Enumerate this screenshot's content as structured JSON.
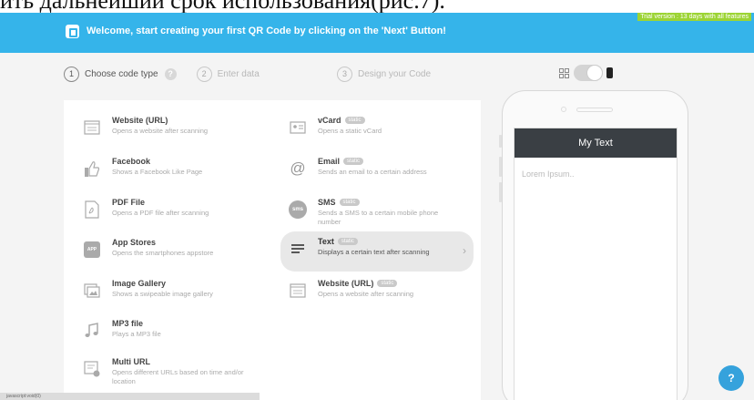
{
  "caption": "ить дальнейший срок использования(рис.7).",
  "trial": "Trial version : 13 days with all features",
  "banner": {
    "welcome": "Welcome, start creating your first QR Code by clicking on the 'Next' Button!"
  },
  "steps": [
    {
      "num": "1",
      "label": "Choose code type"
    },
    {
      "num": "2",
      "label": "Enter data"
    },
    {
      "num": "3",
      "label": "Design your Code"
    }
  ],
  "left_items": [
    {
      "title": "Website (URL)",
      "desc": "Opens a website after scanning",
      "icon": "web-page-icon"
    },
    {
      "title": "Facebook",
      "desc": "Shows a Facebook Like Page",
      "icon": "thumbs-up-icon"
    },
    {
      "title": "PDF File",
      "desc": "Opens a PDF file after scanning",
      "icon": "pdf-icon"
    },
    {
      "title": "App Stores",
      "desc": "Opens the smartphones appstore",
      "icon": "app-icon"
    },
    {
      "title": "Image Gallery",
      "desc": "Shows a swipeable image gallery",
      "icon": "gallery-icon"
    },
    {
      "title": "MP3 file",
      "desc": "Plays a MP3 file",
      "icon": "music-note-icon"
    },
    {
      "title": "Multi URL",
      "desc": "Opens different URLs based on time and/or location",
      "icon": "multi-url-icon"
    }
  ],
  "right_items": [
    {
      "title": "vCard",
      "badge": "static",
      "desc": "Opens a static vCard",
      "icon": "vcard-icon"
    },
    {
      "title": "Email",
      "badge": "static",
      "desc": "Sends an email to a certain address",
      "icon": "at-icon"
    },
    {
      "title": "SMS",
      "badge": "static",
      "desc": "Sends a SMS to a certain mobile phone number",
      "icon": "sms-icon"
    },
    {
      "title": "Text",
      "badge": "static",
      "desc": "Displays a certain text after scanning",
      "icon": "text-lines-icon"
    },
    {
      "title": "Website (URL)",
      "badge": "static",
      "desc": "Opens a website after scanning",
      "icon": "web-page-icon"
    }
  ],
  "preview": {
    "header": "My Text",
    "body": "Lorem Ipsum.."
  },
  "status": "javascript:void(0)",
  "chat_label": "?"
}
